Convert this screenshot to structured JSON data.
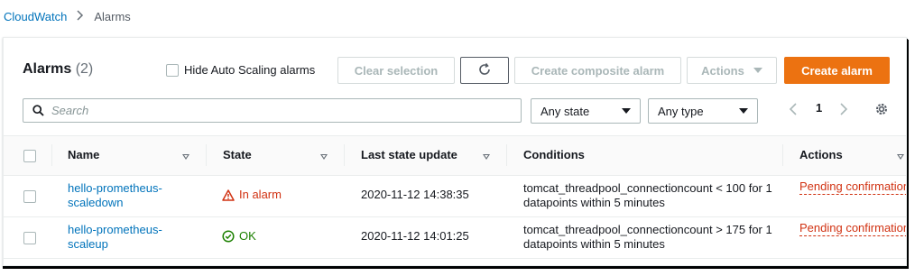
{
  "breadcrumb": {
    "root": "CloudWatch",
    "current": "Alarms"
  },
  "header": {
    "title": "Alarms",
    "count": "(2)"
  },
  "toolbar": {
    "hide_autoscaling_label": "Hide Auto Scaling alarms",
    "clear_selection_label": "Clear selection",
    "create_composite_label": "Create composite alarm",
    "actions_label": "Actions",
    "create_alarm_label": "Create alarm"
  },
  "search": {
    "placeholder": "Search"
  },
  "filters": {
    "state": "Any state",
    "type": "Any type"
  },
  "pagination": {
    "page": "1"
  },
  "table": {
    "columns": [
      "Name",
      "State",
      "Last state update",
      "Conditions",
      "Actions"
    ],
    "rows": [
      {
        "name": "hello-prometheus-scaledown",
        "state": "In alarm",
        "last_update": "2020-11-12 14:38:35",
        "conditions": "tomcat_threadpool_connectioncount < 100 for 1 datapoints within 5 minutes",
        "actions": "Pending confirmation"
      },
      {
        "name": "hello-prometheus-scaleup",
        "state": "OK",
        "last_update": "2020-11-12 14:01:25",
        "conditions": "tomcat_threadpool_connectioncount > 175 for 1 datapoints within 5 minutes",
        "actions": "Pending confirmation"
      }
    ]
  },
  "colors": {
    "link": "#0073bb",
    "primary": "#ec7211",
    "alarm": "#d13212",
    "ok": "#1d8102"
  }
}
